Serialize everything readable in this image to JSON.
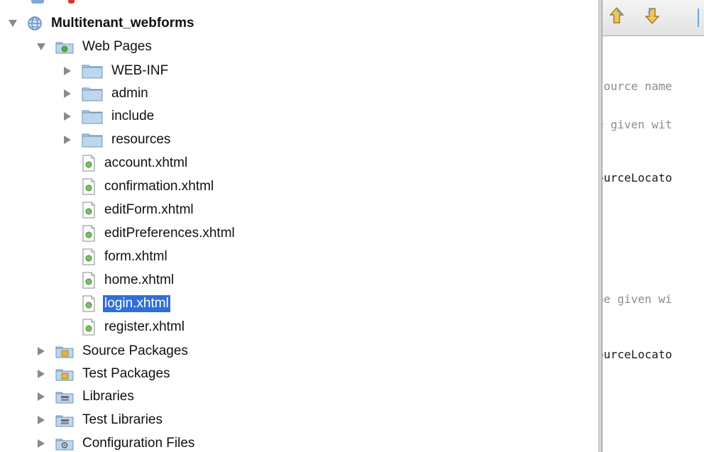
{
  "tree": {
    "root": {
      "label": "Multitenant_webforms",
      "expanded": true
    },
    "web_pages": {
      "label": "Web Pages",
      "expanded": true,
      "folders": [
        {
          "label": "WEB-INF"
        },
        {
          "label": "admin"
        },
        {
          "label": "include"
        },
        {
          "label": "resources"
        }
      ],
      "files": [
        {
          "label": "account.xhtml"
        },
        {
          "label": "confirmation.xhtml"
        },
        {
          "label": "editForm.xhtml"
        },
        {
          "label": "editPreferences.xhtml"
        },
        {
          "label": "form.xhtml"
        },
        {
          "label": "home.xhtml"
        },
        {
          "label": "login.xhtml",
          "selected": true
        },
        {
          "label": "register.xhtml"
        }
      ]
    },
    "siblings": [
      {
        "label": "Source Packages",
        "icon": "source-package-folder-icon"
      },
      {
        "label": "Test Packages",
        "icon": "test-package-folder-icon"
      },
      {
        "label": "Libraries",
        "icon": "libraries-folder-icon"
      },
      {
        "label": "Test Libraries",
        "icon": "test-libraries-folder-icon"
      },
      {
        "label": "Configuration Files",
        "icon": "configuration-folder-icon"
      }
    ]
  },
  "editor": {
    "toolbar_icons": [
      "move-up-icon",
      "move-down-icon"
    ],
    "code_lines": [
      {
        "text": "source name",
        "style": "comment"
      },
      {
        "text": "e given wit",
        "style": "comment"
      },
      {
        "text": "ourceLocato",
        "style": "code"
      },
      {
        "text": "be given wi",
        "style": "comment"
      },
      {
        "text": "ourceLocato",
        "style": "code"
      }
    ]
  },
  "colors": {
    "selection": "#2f6fd6",
    "folder_blue": "#a9cbe8",
    "package_yellow": "#e8b43c",
    "comment_gray": "#8c8c8c"
  }
}
